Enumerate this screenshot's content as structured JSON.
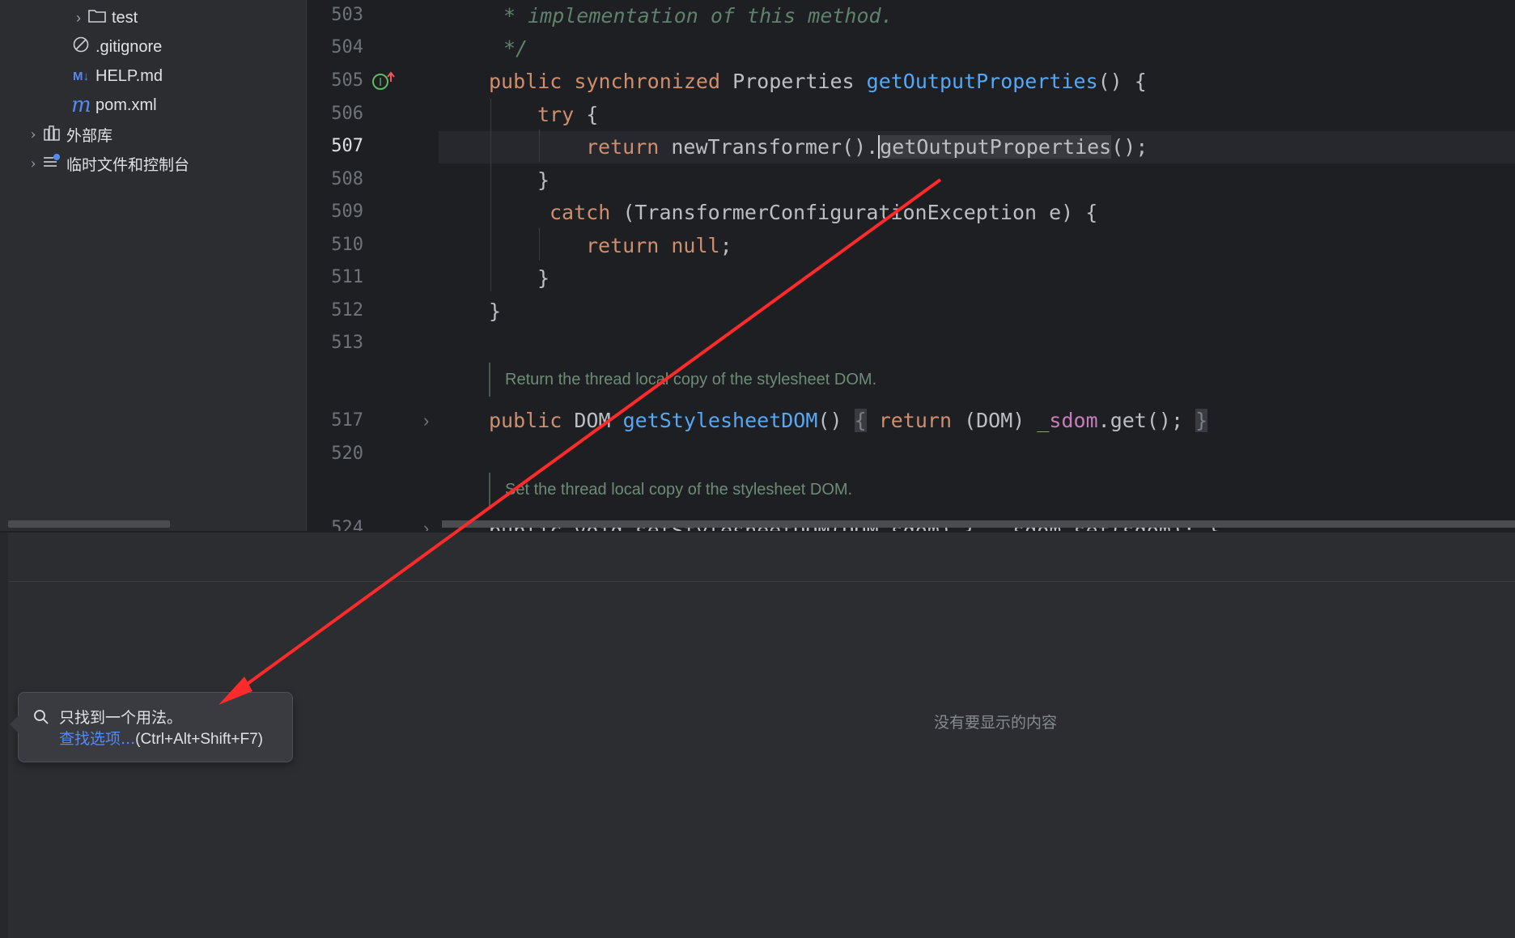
{
  "project_tree": {
    "items": [
      {
        "label": "test",
        "type": "folder",
        "icon": "folder-icon"
      },
      {
        "label": ".gitignore",
        "type": "file",
        "icon": "ignored-file-icon"
      },
      {
        "label": "HELP.md",
        "type": "file",
        "icon": "markdown-icon",
        "icon_text": "M↓"
      },
      {
        "label": "pom.xml",
        "type": "file",
        "icon": "maven-icon",
        "icon_text": "m"
      },
      {
        "label": "外部库",
        "type": "group",
        "icon": "library-icon"
      },
      {
        "label": "临时文件和控制台",
        "type": "group",
        "icon": "scratches-icon"
      }
    ]
  },
  "editor": {
    "line_numbers": [
      "503",
      "504",
      "505",
      "506",
      "507",
      "508",
      "509",
      "510",
      "511",
      "512",
      "513",
      "517",
      "520",
      "524"
    ],
    "current_line": "507",
    "doc_comments": [
      "Return the thread local copy of the stylesheet DOM.",
      "Set the thread local copy of the stylesheet DOM."
    ],
    "gutter_marker": "I",
    "code": {
      "l503": "* implementation of this method.",
      "l504": "*/",
      "l505_kw1": "public",
      "l505_kw2": "synchronized",
      "l505_type": "Properties",
      "l505_fn": "getOutputProperties",
      "l505_rest": "() {",
      "l506_kw": "try",
      "l506_rest": " {",
      "l507_kw": "return",
      "l507_a": " newTransformer().",
      "l507_fn": "getOutputProperties",
      "l507_b": "();",
      "l508": "}",
      "l509_kw": "catch",
      "l509_rest": " (TransformerConfigurationException e) {",
      "l510_kw1": "return",
      "l510_kw2": "null",
      "l510_rest": ";",
      "l511": "}",
      "l512": "}",
      "l517_kw": "public",
      "l517_type": " DOM ",
      "l517_fn": "getStylesheetDOM",
      "l517_paren": "()",
      "l517_ob": "{",
      "l517_ret": "return",
      "l517_cast": " (DOM) ",
      "l517_fld": "_sdom",
      "l517_tail": ".get();",
      "l517_cb": "}",
      "l524": "public void setStylesheetDOM(DOM sdom) {  _sdom.set(sdom); }"
    }
  },
  "find_panel": {
    "empty_text": "没有要显示的内容"
  },
  "popup": {
    "message": "只找到一个用法。",
    "link": "查找选项...",
    "shortcut": "(Ctrl+Alt+Shift+F7)"
  },
  "colors": {
    "keyword": "#cf8e6d",
    "function": "#56a8f5",
    "comment": "#5f826b",
    "field": "#c77dbb",
    "annotation_arrow": "#ff2a2a"
  }
}
